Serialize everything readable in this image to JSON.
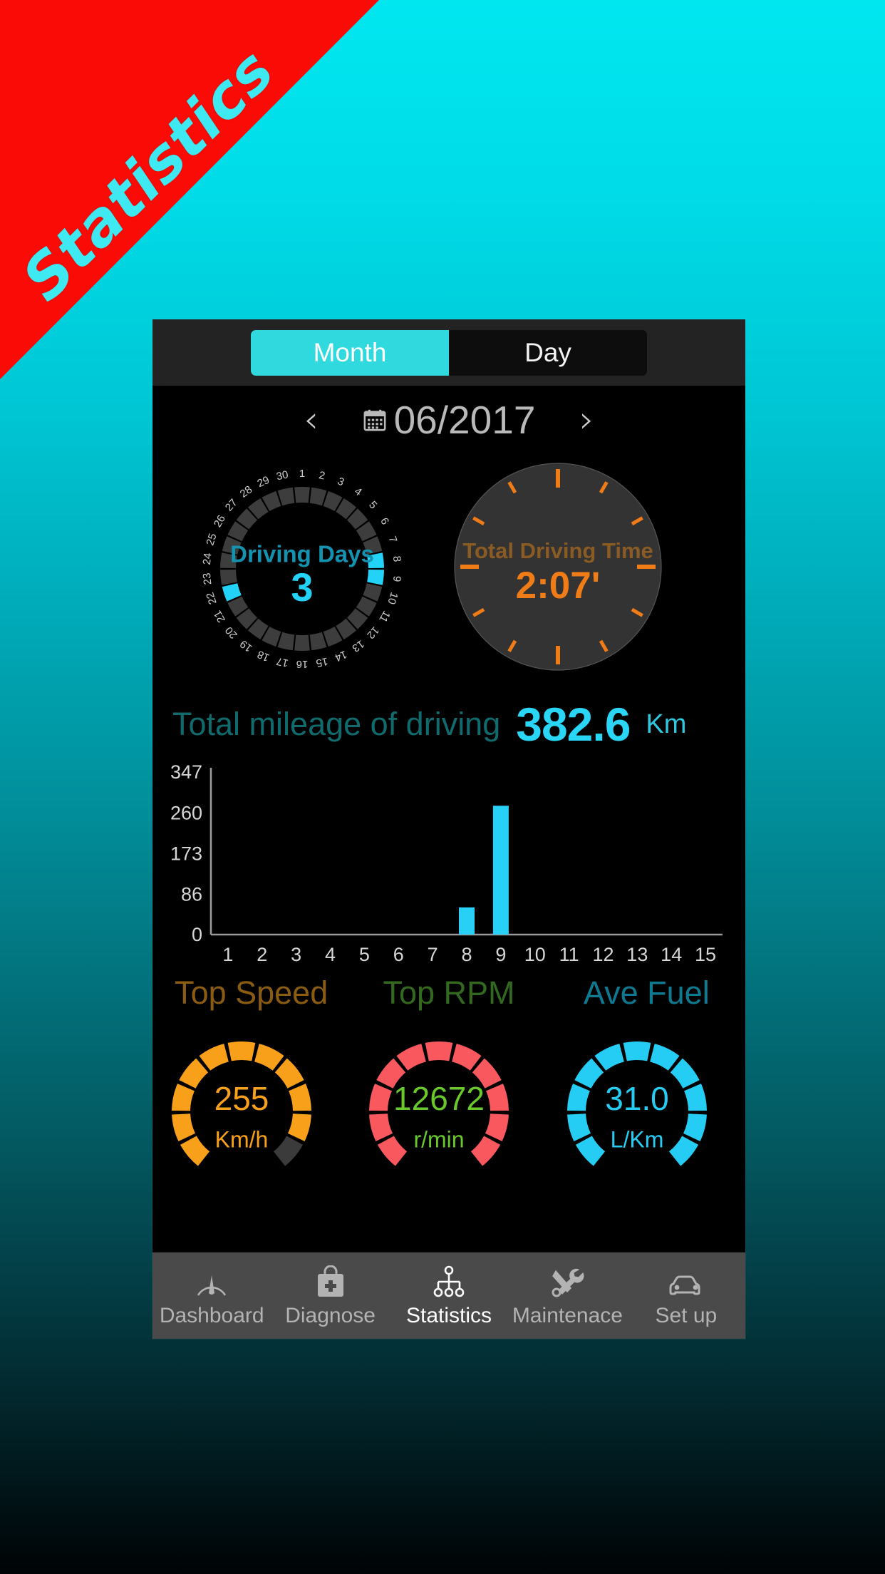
{
  "ribbon": {
    "text": "Statistics",
    "bg_color": "#fb0b05",
    "text_color": "#3fe9f2"
  },
  "tabs": {
    "month_label": "Month",
    "day_label": "Day",
    "active": "Month",
    "active_color": "#2fd9dd"
  },
  "date_nav": {
    "prev_icon": "‹",
    "next_icon": "›",
    "calendar_icon": "calendar-icon",
    "value": "06/2017"
  },
  "driving_days": {
    "title": "Driving Days",
    "value": "3",
    "title_color": "#1493b0",
    "value_color": "#23d3f7",
    "inactive_color": "#3d3d3d",
    "total_days": 30,
    "day_labels": [
      1,
      2,
      3,
      4,
      5,
      6,
      7,
      8,
      9,
      10,
      11,
      12,
      13,
      14,
      15,
      16,
      17,
      18,
      19,
      20,
      21,
      22,
      23,
      24,
      25,
      26,
      27,
      28,
      29,
      30
    ],
    "active_days": [
      8,
      9,
      22
    ]
  },
  "driving_time": {
    "title": "Total Driving Time",
    "value": "2:07'",
    "title_color": "#8a5c23",
    "value_color": "#f07c18",
    "tick_color": "#f07c18",
    "face_color": "#333333",
    "tick_count": 12
  },
  "mileage": {
    "label": "Total mileage of driving",
    "value": "382.6",
    "unit": "Km",
    "label_color": "#0f6b6e",
    "value_color": "#29d6f5"
  },
  "chart_data": {
    "type": "bar",
    "title": "",
    "xlabel": "",
    "ylabel": "",
    "categories": [
      "1",
      "2",
      "3",
      "4",
      "5",
      "6",
      "7",
      "8",
      "9",
      "10",
      "11",
      "12",
      "13",
      "14",
      "15"
    ],
    "values": [
      0,
      0,
      0,
      0,
      0,
      0,
      0,
      58,
      275,
      0,
      0,
      0,
      0,
      0,
      0
    ],
    "yticks": [
      "0",
      "86",
      "173",
      "260",
      "347"
    ],
    "ytick_values": [
      0,
      86,
      173,
      260,
      347
    ],
    "ylim": [
      0,
      347
    ],
    "bar_color": "#29d0f5",
    "axis_color": "#9a9a9a",
    "tick_label_color": "#d6d6d6",
    "grid": false,
    "legend": false
  },
  "gauges": [
    {
      "label": "Top Speed",
      "value": "255",
      "unit": "Km/h",
      "arc_color": "#f9a01b",
      "label_color": "#8a5c12",
      "text_color": "#f9a01b",
      "segments": 11,
      "filled_segments": 10
    },
    {
      "label": "Top RPM",
      "value": "12672",
      "unit": "r/min",
      "arc_color": "#f9595e",
      "label_color": "#33691e",
      "text_color": "#69c92b",
      "segments": 11,
      "filled_segments": 11
    },
    {
      "label": "Ave Fuel",
      "value": "31.0",
      "unit": "L/Km",
      "arc_color": "#25cdf5",
      "label_color": "#0e7a91",
      "text_color": "#25cdf5",
      "segments": 11,
      "filled_segments": 11
    }
  ],
  "bottom_nav": {
    "active": "Statistics",
    "items": [
      {
        "label": "Dashboard",
        "icon": "speedometer-icon"
      },
      {
        "label": "Diagnose",
        "icon": "medical-bag-icon"
      },
      {
        "label": "Statistics",
        "icon": "hierarchy-icon"
      },
      {
        "label": "Maintenace",
        "icon": "tools-icon"
      },
      {
        "label": "Set up",
        "icon": "car-icon"
      }
    ]
  }
}
